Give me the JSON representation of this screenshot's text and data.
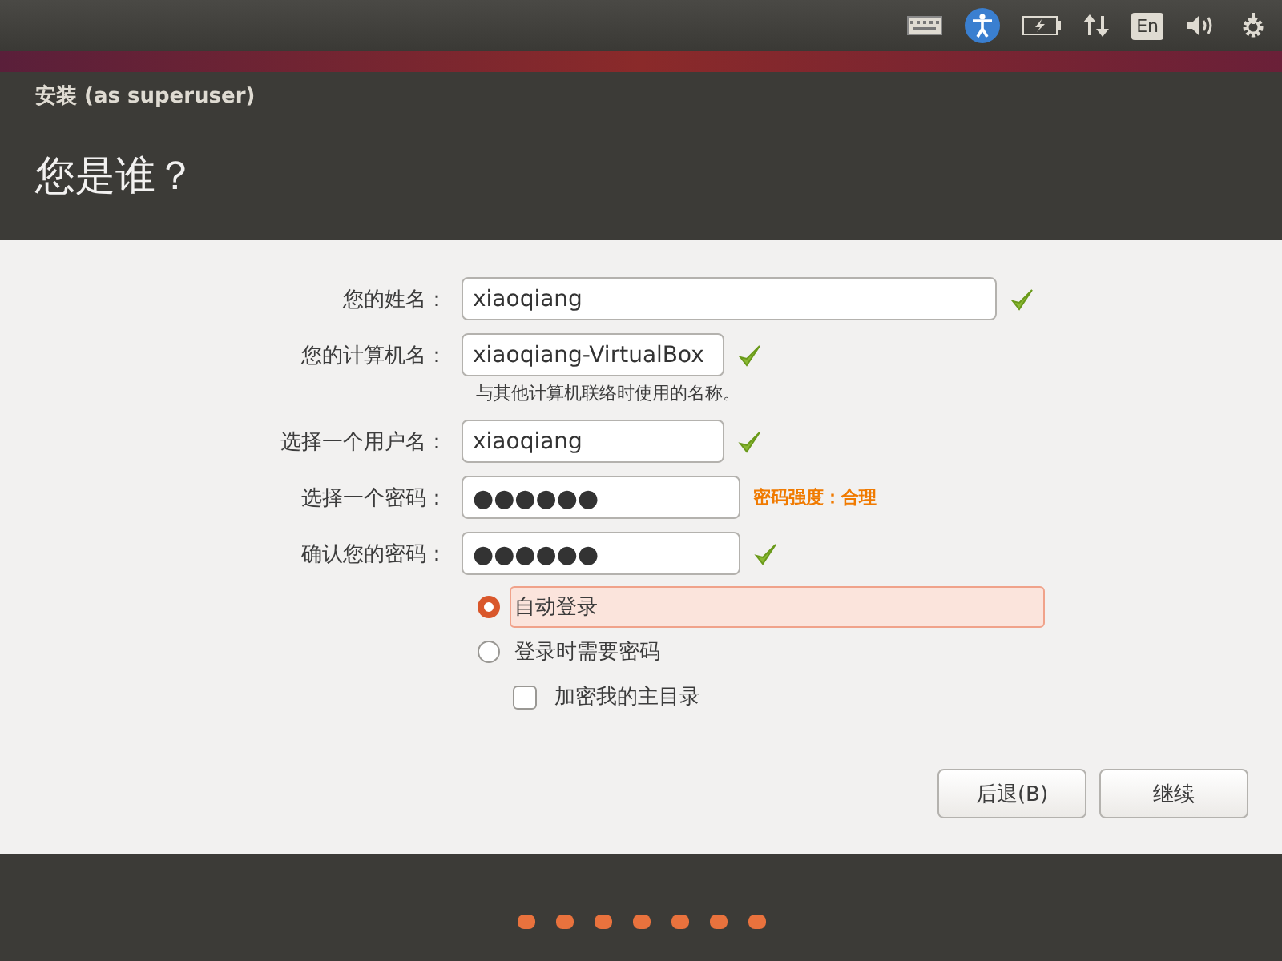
{
  "top_panel": {
    "language": "En"
  },
  "window": {
    "title": "安装 (as superuser)",
    "heading": "您是谁？"
  },
  "fields": [
    {
      "label": "您的姓名：",
      "value": "xiaoqiang",
      "kind": "wide",
      "valid": true
    },
    {
      "label": "您的计算机名：",
      "value": "xiaoqiang-VirtualBox",
      "kind": "short",
      "valid": true,
      "hint": "与其他计算机联络时使用的名称。"
    },
    {
      "label": "选择一个用户名：",
      "value": "xiaoqiang",
      "kind": "short",
      "valid": true
    },
    {
      "label": "选择一个密码：",
      "value": "●●●●●●",
      "kind": "password",
      "valid": false,
      "strength": "密码强度：合理"
    },
    {
      "label": "确认您的密码：",
      "value": "●●●●●●",
      "kind": "password",
      "valid": true
    }
  ],
  "login_options": [
    {
      "label": "自动登录",
      "selected": true
    },
    {
      "label": "登录时需要密码",
      "selected": false
    }
  ],
  "encrypt_home": {
    "label": "加密我的主目录",
    "checked": false
  },
  "buttons": [
    {
      "label": "后退(B)"
    },
    {
      "label": "继续"
    }
  ]
}
